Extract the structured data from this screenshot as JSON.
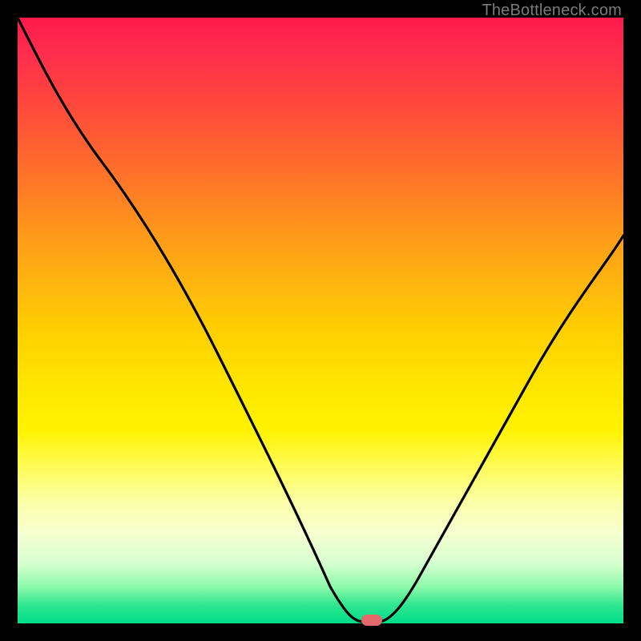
{
  "attribution": "TheBottleneck.com",
  "chart_data": {
    "type": "line",
    "title": "",
    "xlabel": "",
    "ylabel": "",
    "xlim": [
      0,
      100
    ],
    "ylim": [
      0,
      100
    ],
    "series": [
      {
        "name": "bottleneck-curve",
        "x": [
          0,
          6,
          14,
          22,
          30,
          38,
          46,
          51,
          54,
          56,
          58,
          60,
          64,
          70,
          78,
          86,
          94,
          100
        ],
        "y": [
          100,
          92,
          82,
          71,
          58,
          44,
          27,
          12,
          3,
          0,
          0,
          0,
          4,
          12,
          26,
          41,
          55,
          64
        ]
      }
    ],
    "marker": {
      "x": 58,
      "y": 0,
      "label": "optimal-point"
    },
    "gradient_stops": [
      {
        "pos": 0,
        "color": "#ff1a4d"
      },
      {
        "pos": 50,
        "color": "#ffd000"
      },
      {
        "pos": 80,
        "color": "#fbffa8"
      },
      {
        "pos": 100,
        "color": "#00dd8a"
      }
    ]
  }
}
